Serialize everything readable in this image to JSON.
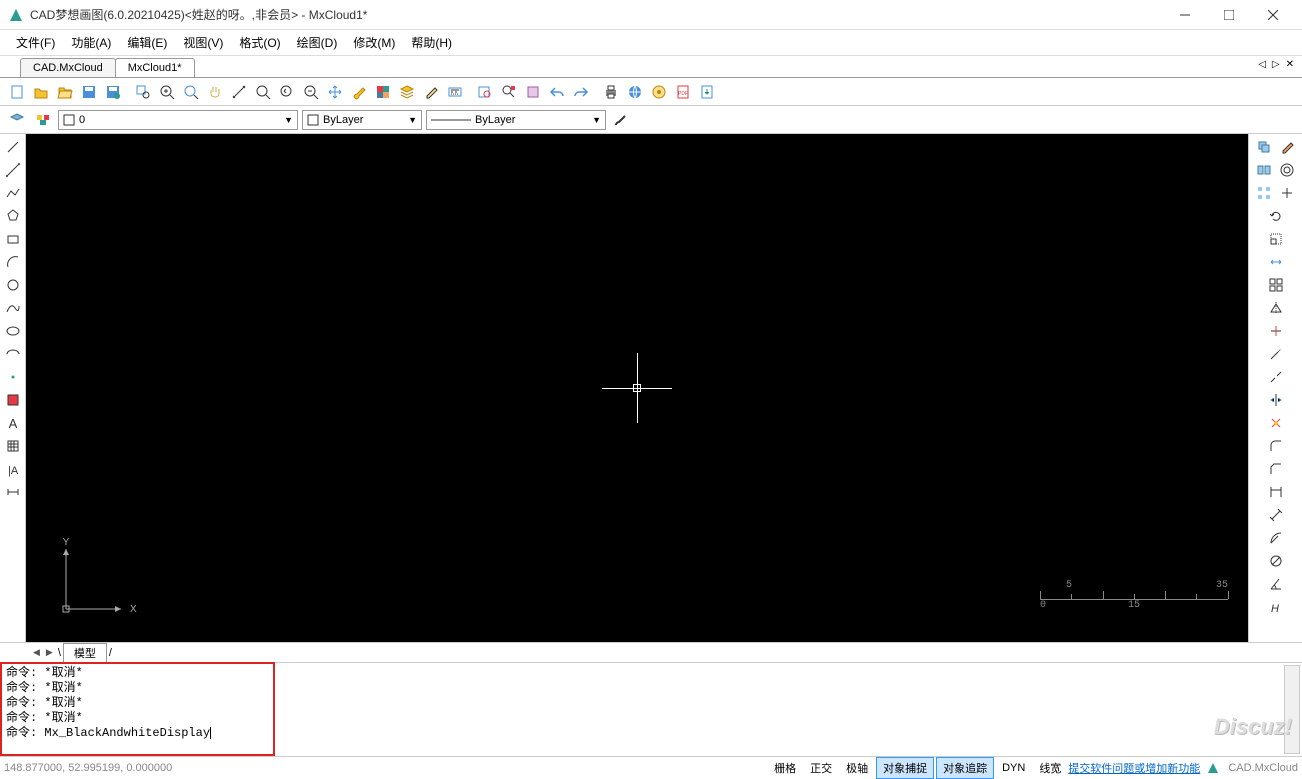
{
  "window": {
    "title": "CAD梦想画图(6.0.20210425)<姓赵的呀。,非会员> - MxCloud1*"
  },
  "menu": [
    "文件(F)",
    "功能(A)",
    "编辑(E)",
    "视图(V)",
    "格式(O)",
    "绘图(D)",
    "修改(M)",
    "帮助(H)"
  ],
  "tabs": {
    "items": [
      {
        "label": "CAD.MxCloud",
        "active": false
      },
      {
        "label": "MxCloud1*",
        "active": true
      }
    ]
  },
  "layerbar": {
    "layer_combo": "0",
    "color_combo": "ByLayer",
    "linetype_combo": "ByLayer"
  },
  "ruler": {
    "top": [
      "5",
      "35"
    ],
    "bottom": [
      "0",
      "15"
    ]
  },
  "modeltab": {
    "label": "模型"
  },
  "commands": {
    "history": [
      "命令:  *取消*",
      "命令:  *取消*",
      "命令:  *取消*",
      "命令:  *取消*"
    ],
    "prompt": "命令:",
    "input": "Mx_BlackAndwhiteDisplay"
  },
  "status": {
    "coords": "148.877000,  52.995199,  0.000000",
    "buttons": [
      {
        "label": "栅格",
        "active": false
      },
      {
        "label": "正交",
        "active": false
      },
      {
        "label": "极轴",
        "active": false
      },
      {
        "label": "对象捕捉",
        "active": true
      },
      {
        "label": "对象追踪",
        "active": true
      },
      {
        "label": "DYN",
        "active": false
      },
      {
        "label": "线宽",
        "active": false
      }
    ],
    "link": "提交软件问题或增加新功能",
    "brand": "CAD.MxCloud"
  },
  "watermark": "Discuz!"
}
